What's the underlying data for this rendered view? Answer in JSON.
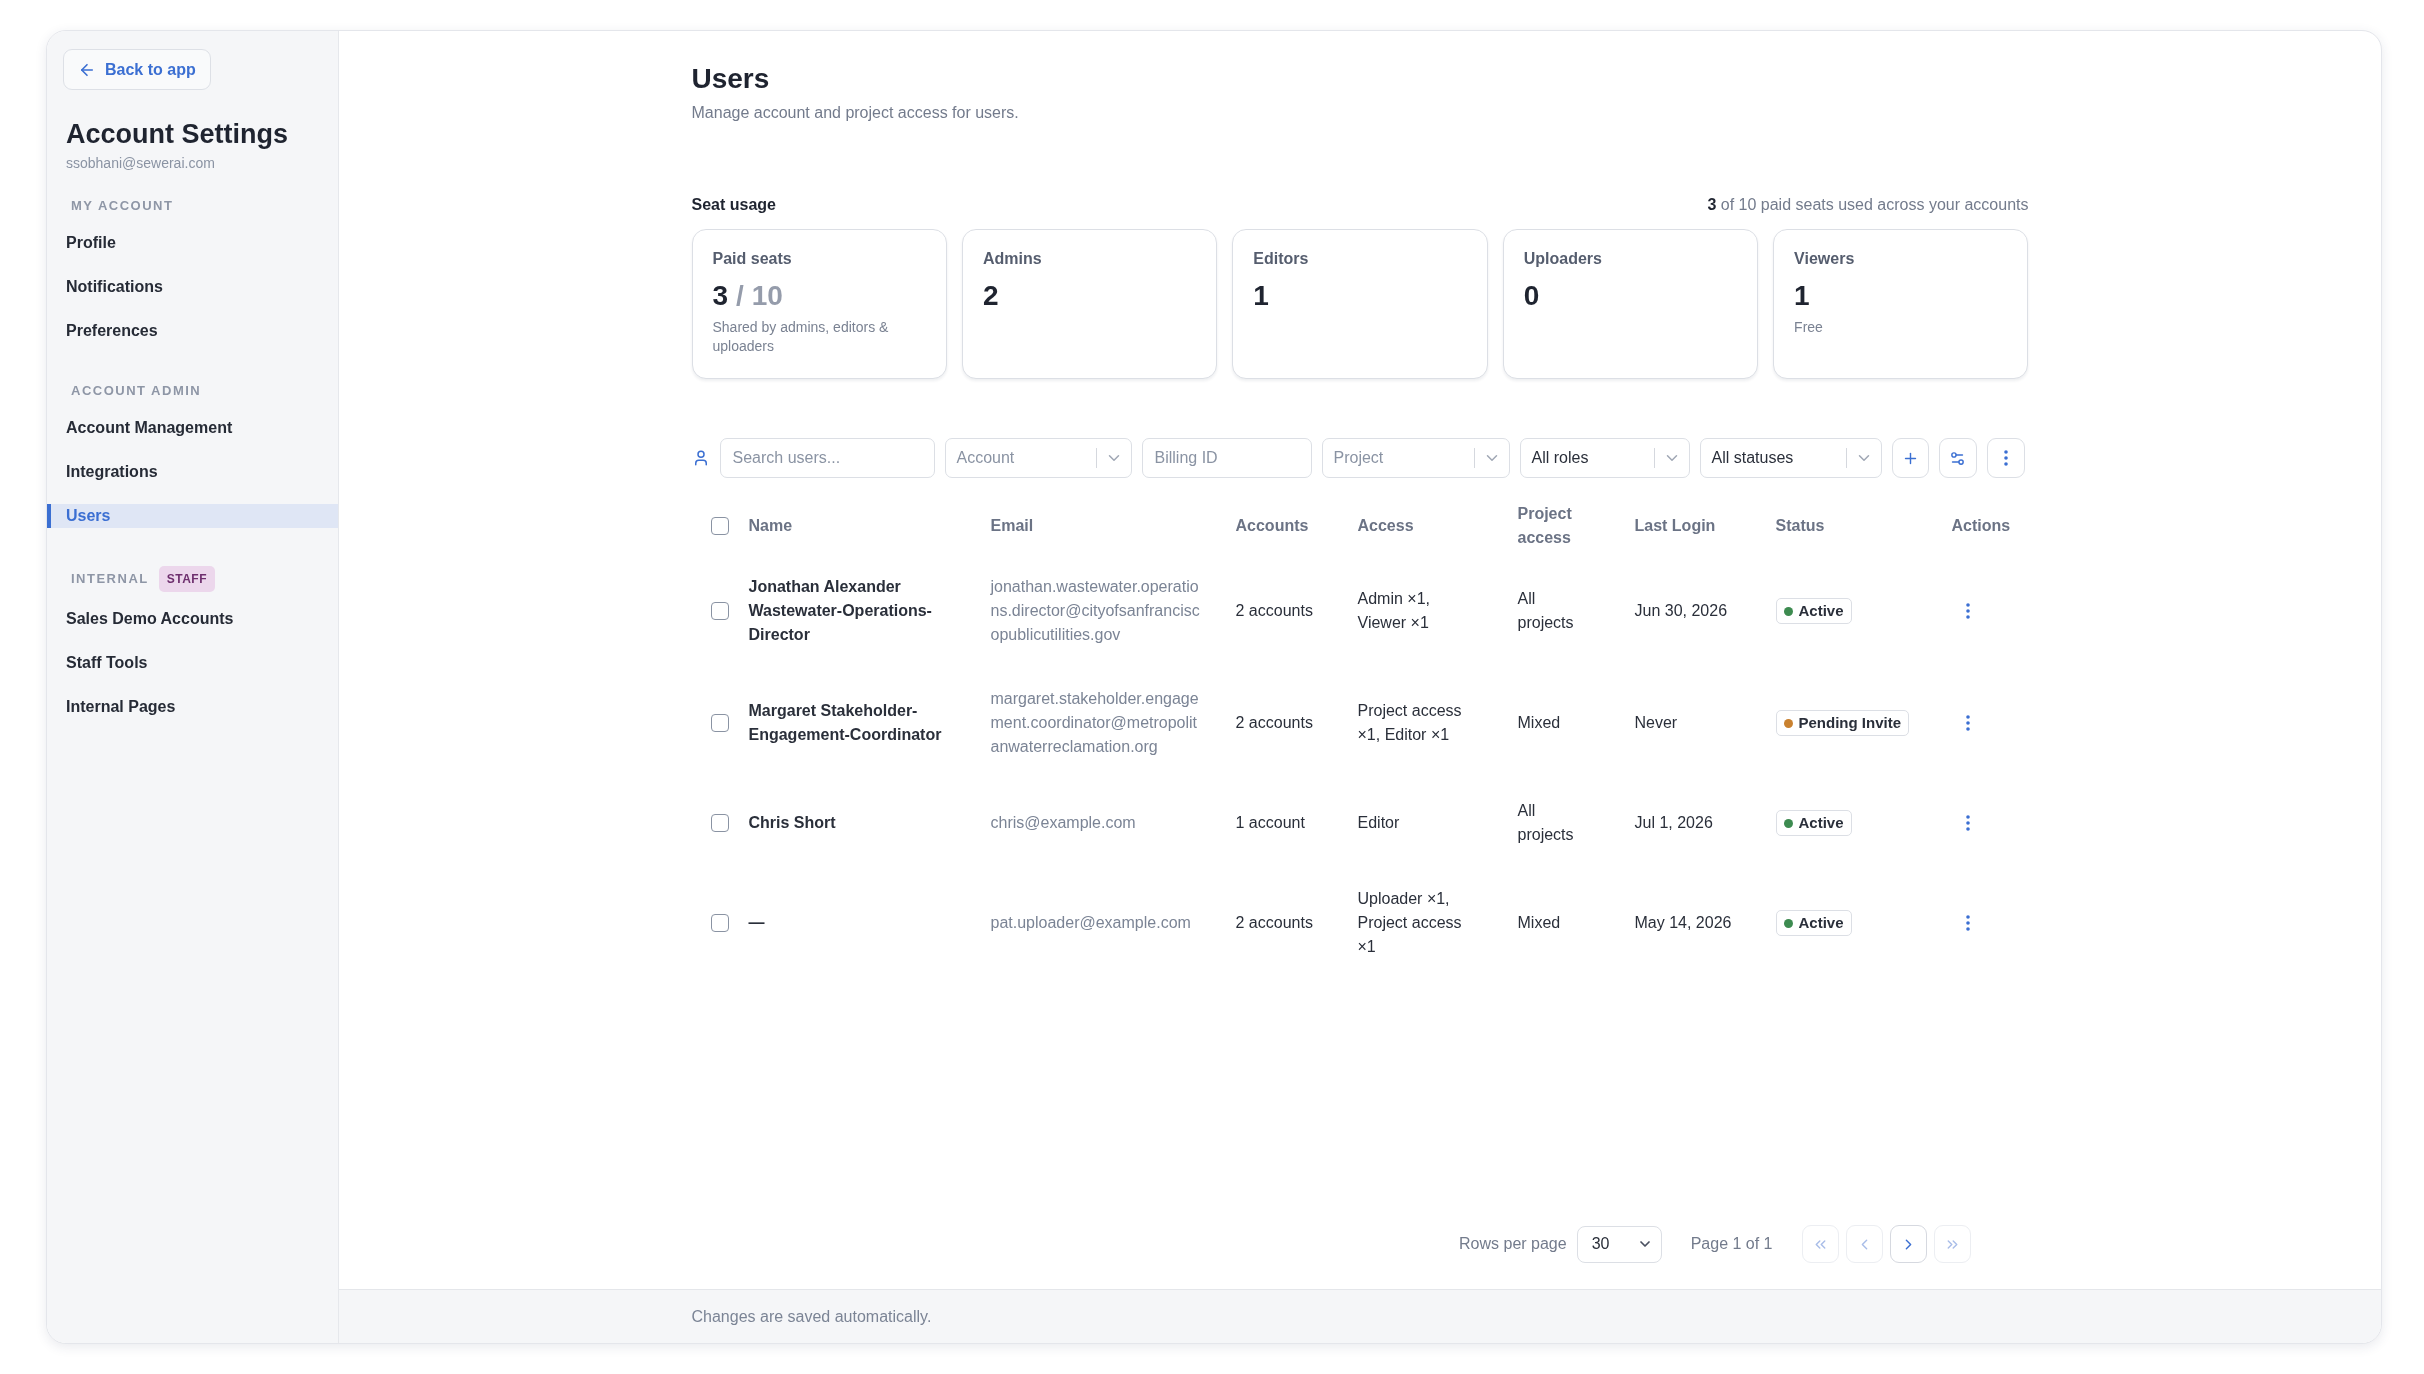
{
  "sidebar": {
    "back_button": "Back to app",
    "title": "Account Settings",
    "email": "ssobhani@sewerai.com",
    "sections": [
      {
        "label": "MY ACCOUNT",
        "items": [
          {
            "label": "Profile",
            "selected": false
          },
          {
            "label": "Notifications",
            "selected": false
          },
          {
            "label": "Preferences",
            "selected": false
          }
        ]
      },
      {
        "label": "ACCOUNT ADMIN",
        "items": [
          {
            "label": "Account Management",
            "selected": false
          },
          {
            "label": "Integrations",
            "selected": false
          },
          {
            "label": "Users",
            "selected": true
          }
        ]
      },
      {
        "label": "INTERNAL",
        "badge": "STAFF",
        "items": [
          {
            "label": "Sales Demo Accounts",
            "selected": false
          },
          {
            "label": "Staff Tools",
            "selected": false
          },
          {
            "label": "Internal Pages",
            "selected": false
          }
        ]
      }
    ]
  },
  "header": {
    "title": "Users",
    "subtitle": "Manage account and project access for users."
  },
  "seat_usage": {
    "heading": "Seat usage",
    "summary": "**3** of 10 paid seats used across your accounts",
    "cards": [
      {
        "label": "Paid seats",
        "value": "3",
        "total": "/ 10",
        "note": "Shared by admins, editors & uploaders"
      },
      {
        "label": "Admins",
        "value": "2"
      },
      {
        "label": "Editors",
        "value": "1"
      },
      {
        "label": "Uploaders",
        "value": "0"
      },
      {
        "label": "Viewers",
        "value": "1",
        "note": "Free"
      }
    ]
  },
  "filters": [
    {
      "kind": "search",
      "placeholder": "Search users..."
    },
    {
      "kind": "select",
      "placeholder": "Account"
    },
    {
      "kind": "input",
      "placeholder": "Billing ID"
    },
    {
      "kind": "select",
      "placeholder": "Project"
    },
    {
      "kind": "select",
      "value": "All roles"
    },
    {
      "kind": "select",
      "value": "All statuses"
    }
  ],
  "table": {
    "select_all_checked": false,
    "columns": [
      "Name",
      "Email",
      "Accounts",
      "Access",
      "Project access",
      "Last Login",
      "Status",
      "Actions"
    ],
    "rows": [
      {
        "checked": false,
        "name": "Jonathan Alexander Wastewater-Operations-Director",
        "email": "jonathan.wastewater.operations.director@cityofsanfranciscopublicutilities.gov",
        "accounts": "2 accounts",
        "access": "Admin ×1, Viewer ×1",
        "project_access": "All projects",
        "last_login": "Jun 30, 2026",
        "status": {
          "label": "Active",
          "color": "#3d8b50"
        }
      },
      {
        "checked": false,
        "name": "Margaret Stakeholder-Engagement-Coordinator",
        "email": "margaret.stakeholder.engagement.coordinator@metropolitanwaterreclamation.org",
        "accounts": "2 accounts",
        "access": "Project access ×1, Editor ×1",
        "project_access": "Mixed",
        "last_login": "Never",
        "status": {
          "label": "Pending Invite",
          "color": "#c9812f"
        }
      },
      {
        "checked": false,
        "name": "Chris Short",
        "email": "chris@example.com",
        "accounts": "1 account",
        "access": "Editor",
        "project_access": "All projects",
        "last_login": "Jul 1, 2026",
        "status": {
          "label": "Active",
          "color": "#3d8b50"
        }
      },
      {
        "checked": false,
        "name": "—",
        "email": "pat.uploader@example.com",
        "accounts": "2 accounts",
        "access": "Uploader ×1, Project access ×1",
        "project_access": "Mixed",
        "last_login": "May 14, 2026",
        "status": {
          "label": "Active",
          "color": "#3d8b50"
        }
      }
    ]
  },
  "pagination": {
    "label": "Rows per page",
    "rows_per_page": "30",
    "page_info": "Page 1 of 1",
    "buttons": [
      {
        "kind": "first",
        "disabled": true
      },
      {
        "kind": "previous",
        "disabled": true
      },
      {
        "kind": "next",
        "disabled": false
      },
      {
        "kind": "last",
        "disabled": true
      }
    ]
  },
  "footer": {
    "note": "Changes are saved automatically."
  }
}
